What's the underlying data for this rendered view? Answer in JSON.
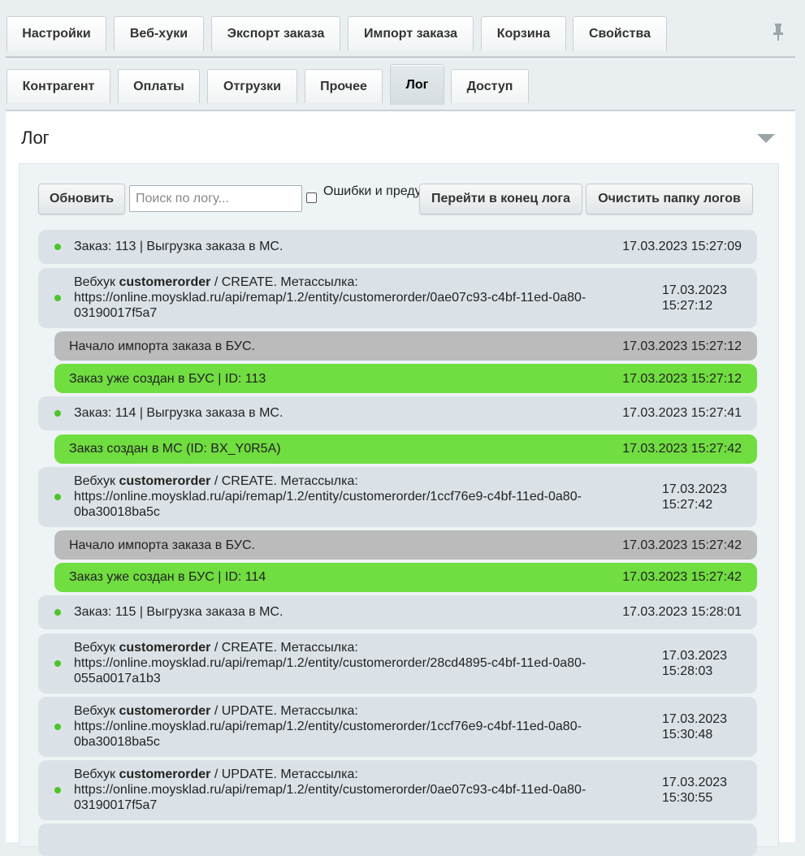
{
  "top_tabs": [
    "Настройки",
    "Веб-хуки",
    "Экспорт заказа",
    "Импорт заказа",
    "Корзина",
    "Свойства"
  ],
  "sub_tabs": [
    "Контрагент",
    "Оплаты",
    "Отгрузки",
    "Прочее",
    "Лог",
    "Доступ"
  ],
  "active_sub_tab": "Лог",
  "panel": {
    "title": "Лог"
  },
  "toolbar": {
    "refresh_label": "Обновить",
    "search_placeholder": "Поиск по логу...",
    "errors_label": "Ошибки и предупреждения",
    "goto_end_label": "Перейти в конец лога",
    "clear_label": "Очистить папку логов"
  },
  "log": [
    {
      "type": "info",
      "text": "Заказ: 113 | Выгрузка заказа в МС.",
      "time": "17.03.2023 15:27:09"
    },
    {
      "type": "webhook",
      "prefix": "Вебхук ",
      "entity": "customerorder",
      "action": " / CREATE. Метассылка:",
      "url1": "https://online.moysklad.ru/api/remap/1.2/entity/customerorder/0ae07c93-c4bf-11ed-0a80-",
      "url2": "03190017f5a7",
      "date": "17.03.2023",
      "clock": "15:27:12"
    },
    {
      "type": "gray",
      "text": "Начало импорта заказа в БУС.",
      "time": "17.03.2023 15:27:12"
    },
    {
      "type": "green",
      "text": "Заказ уже создан в БУС | ID: 113",
      "time": "17.03.2023 15:27:12"
    },
    {
      "type": "info",
      "text": "Заказ: 114 | Выгрузка заказа в МС.",
      "time": "17.03.2023 15:27:41"
    },
    {
      "type": "green",
      "text": "Заказ создан в МС (ID: BX_Y0R5A)",
      "time": "17.03.2023 15:27:42"
    },
    {
      "type": "webhook",
      "prefix": "Вебхук ",
      "entity": "customerorder",
      "action": " / CREATE. Метассылка:",
      "url1": "https://online.moysklad.ru/api/remap/1.2/entity/customerorder/1ccf76e9-c4bf-11ed-0a80-",
      "url2": "0ba30018ba5c",
      "date": "17.03.2023",
      "clock": "15:27:42"
    },
    {
      "type": "gray",
      "text": "Начало импорта заказа в БУС.",
      "time": "17.03.2023 15:27:42"
    },
    {
      "type": "green",
      "text": "Заказ уже создан в БУС | ID: 114",
      "time": "17.03.2023 15:27:42"
    },
    {
      "type": "info",
      "text": "Заказ: 115 | Выгрузка заказа в МС.",
      "time": "17.03.2023 15:28:01"
    },
    {
      "type": "webhook",
      "prefix": "Вебхук ",
      "entity": "customerorder",
      "action": " / CREATE. Метассылка:",
      "url1": "https://online.moysklad.ru/api/remap/1.2/entity/customerorder/28cd4895-c4bf-11ed-0a80-",
      "url2": "055a0017a1b3",
      "date": "17.03.2023",
      "clock": "15:28:03"
    },
    {
      "type": "webhook",
      "prefix": "Вебхук ",
      "entity": "customerorder",
      "action": " / UPDATE. Метассылка:",
      "url1": "https://online.moysklad.ru/api/remap/1.2/entity/customerorder/1ccf76e9-c4bf-11ed-0a80-",
      "url2": "0ba30018ba5c",
      "date": "17.03.2023",
      "clock": "15:30:48"
    },
    {
      "type": "webhook",
      "prefix": "Вебхук ",
      "entity": "customerorder",
      "action": " / UPDATE. Метассылка:",
      "url1": "https://online.moysklad.ru/api/remap/1.2/entity/customerorder/0ae07c93-c4bf-11ed-0a80-",
      "url2": "03190017f5a7",
      "date": "17.03.2023",
      "clock": "15:30:55"
    }
  ],
  "colors": {
    "info_row": "#dbe2e7",
    "gray_row": "#bbbbbb",
    "green_row": "#70dd41",
    "dot": "#4ec32b"
  },
  "icons": {
    "pin": "pin-icon",
    "collapse": "triangle-down-icon"
  }
}
